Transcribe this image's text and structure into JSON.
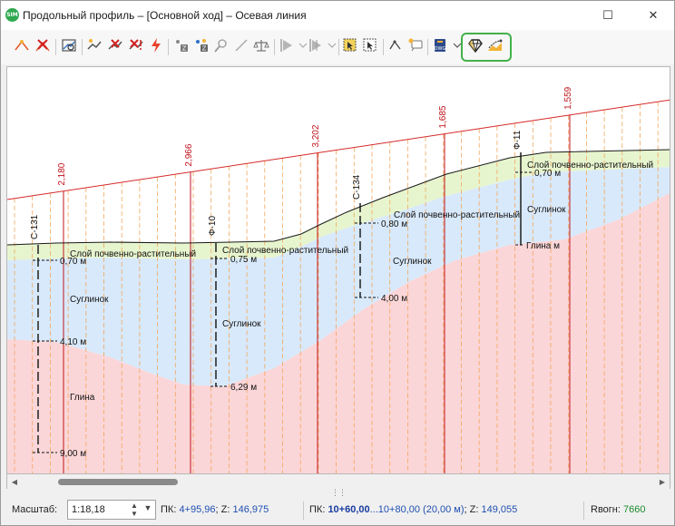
{
  "window": {
    "app_icon_text": "SIM",
    "title": "Продольный профиль – [Основной ход] – Осевая линия",
    "maximize_glyph": "☐",
    "close_glyph": "✕"
  },
  "profile": {
    "elevation_labels": [
      {
        "text": "2,180"
      },
      {
        "text": "2,966"
      },
      {
        "text": "3,202"
      },
      {
        "text": "1,685"
      },
      {
        "text": "1,559"
      }
    ],
    "boreholes": [
      {
        "id": "С-131",
        "depths": [
          "0,70 м",
          "4,10 м",
          "9,00 м"
        ]
      },
      {
        "id": "Ф-10",
        "depths": [
          "0,75 м",
          "6,29 м"
        ]
      },
      {
        "id": "С-134",
        "depths": [
          "0,80 м",
          "4,00 м"
        ]
      },
      {
        "id": "Ф-11",
        "depths": [
          "0,70 м",
          "Глина м"
        ]
      }
    ],
    "layers": {
      "topsoil": "Слой почвенно-растительный",
      "loam": "Суглинок",
      "clay": "Глина"
    },
    "colors": {
      "topsoil": "#e7f5cf",
      "loam": "#d8e9fb",
      "clay": "#fbd6d8",
      "design_line": "#d62828",
      "station_line": "#c0141c",
      "grid_line": "#f3a65b"
    }
  },
  "statusbar": {
    "scale_label": "Масштаб:",
    "scale_value": "1:18,18",
    "pk_label": "ПК:",
    "pk_value": "4+95,96",
    "z_label": "; Z:",
    "z_value": "146,975",
    "pk2_label": "ПК:",
    "pk2_value": "10+60,00",
    "pk2_range": "...10+80,00 (20,00 м)",
    "z2_label": "; Z:",
    "z2_value": "149,055",
    "rvogn_label": "Rвогн:",
    "rvogn_value": "7660"
  }
}
